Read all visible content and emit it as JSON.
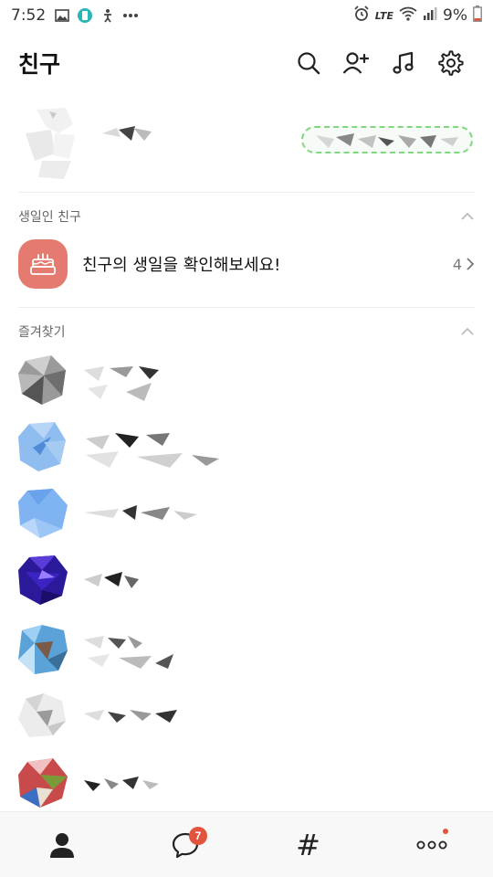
{
  "status_bar": {
    "time": "7:52",
    "battery": "9%",
    "network": "LTE"
  },
  "header": {
    "title": "친구"
  },
  "birthday_section": {
    "title": "생일인 친구",
    "message": "친구의 생일을 확인해보세요!",
    "count": "4"
  },
  "favorites_section": {
    "title": "즐겨찾기"
  },
  "bottom_nav": {
    "chats_badge": "7",
    "openchat_label": "#"
  },
  "colors": {
    "accent": "#e2543d",
    "birthday_icon_bg": "#e57b70",
    "status_ring": "#7ed87e"
  }
}
